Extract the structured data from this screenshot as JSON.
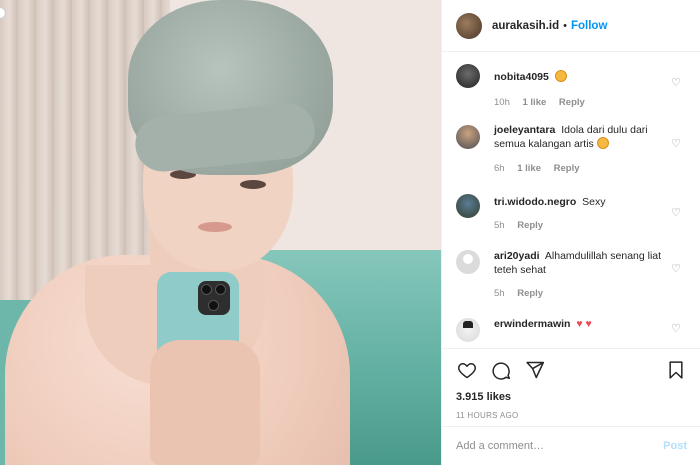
{
  "post": {
    "username": "aurakasih.id",
    "separator": "•",
    "follow_label": "Follow"
  },
  "comments": [
    {
      "user": "nobita4095",
      "text": "",
      "emoji": "star-struck-emoji",
      "time": "10h",
      "likes": "1 like",
      "reply": "Reply"
    },
    {
      "user": "joeleyantara",
      "text": "Idola dari dulu dari semua kalangan artis",
      "emoji": "star-struck-emoji",
      "time": "6h",
      "likes": "1 like",
      "reply": "Reply"
    },
    {
      "user": "tri.widodo.negro",
      "text": "Sexy",
      "emoji": "",
      "time": "5h",
      "likes": "",
      "reply": "Reply"
    },
    {
      "user": "ari20yadi",
      "text": "Alhamdulillah senang liat teteh sehat",
      "emoji": "",
      "time": "5h",
      "likes": "",
      "reply": "Reply"
    },
    {
      "user": "erwindermawin",
      "text": "",
      "emoji": "two-red-hearts",
      "hearts": "♥ ♥",
      "time": "",
      "likes": "",
      "reply": ""
    }
  ],
  "actions": {
    "like_icon": "heart-icon",
    "comment_icon": "comment-icon",
    "share_icon": "share-icon",
    "save_icon": "bookmark-icon"
  },
  "stats": {
    "likes": "3.915 likes",
    "timestamp": "11 HOURS AGO"
  },
  "add_comment": {
    "placeholder": "Add a comment…",
    "post_label": "Post"
  },
  "colors": {
    "link_blue": "#0095f6",
    "post_disabled": "#b2dffc",
    "meta_gray": "#8e8e8e",
    "heart_red": "#ed4956"
  }
}
